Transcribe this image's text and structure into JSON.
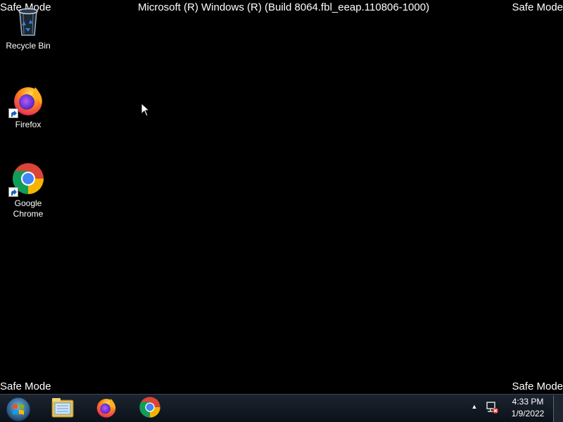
{
  "watermark": {
    "top_left": "Safe Mode",
    "top_right": "Safe Mode",
    "bottom_left": "Safe Mode",
    "bottom_right": "Safe Mode",
    "build": "Microsoft (R) Windows (R) (Build 8064.fbl_eeap.110806-1000)"
  },
  "desktop_icons": [
    {
      "label": "Recycle Bin",
      "icon": "recycle-bin-icon"
    },
    {
      "label": "Firefox",
      "icon": "firefox-icon"
    },
    {
      "label": "Google Chrome",
      "icon": "chrome-icon"
    }
  ],
  "taskbar": {
    "pinned": [
      {
        "icon": "file-explorer-icon"
      },
      {
        "icon": "firefox-icon"
      },
      {
        "icon": "chrome-icon"
      }
    ],
    "tray": {
      "overflow_icon": "chevron-up-icon",
      "network_icon": "network-disconnected-icon"
    },
    "clock": {
      "time": "4:33 PM",
      "date": "1/9/2022"
    }
  },
  "colors": {
    "background": "#000000",
    "taskbar": "#121a24",
    "text": "#ffffff"
  }
}
